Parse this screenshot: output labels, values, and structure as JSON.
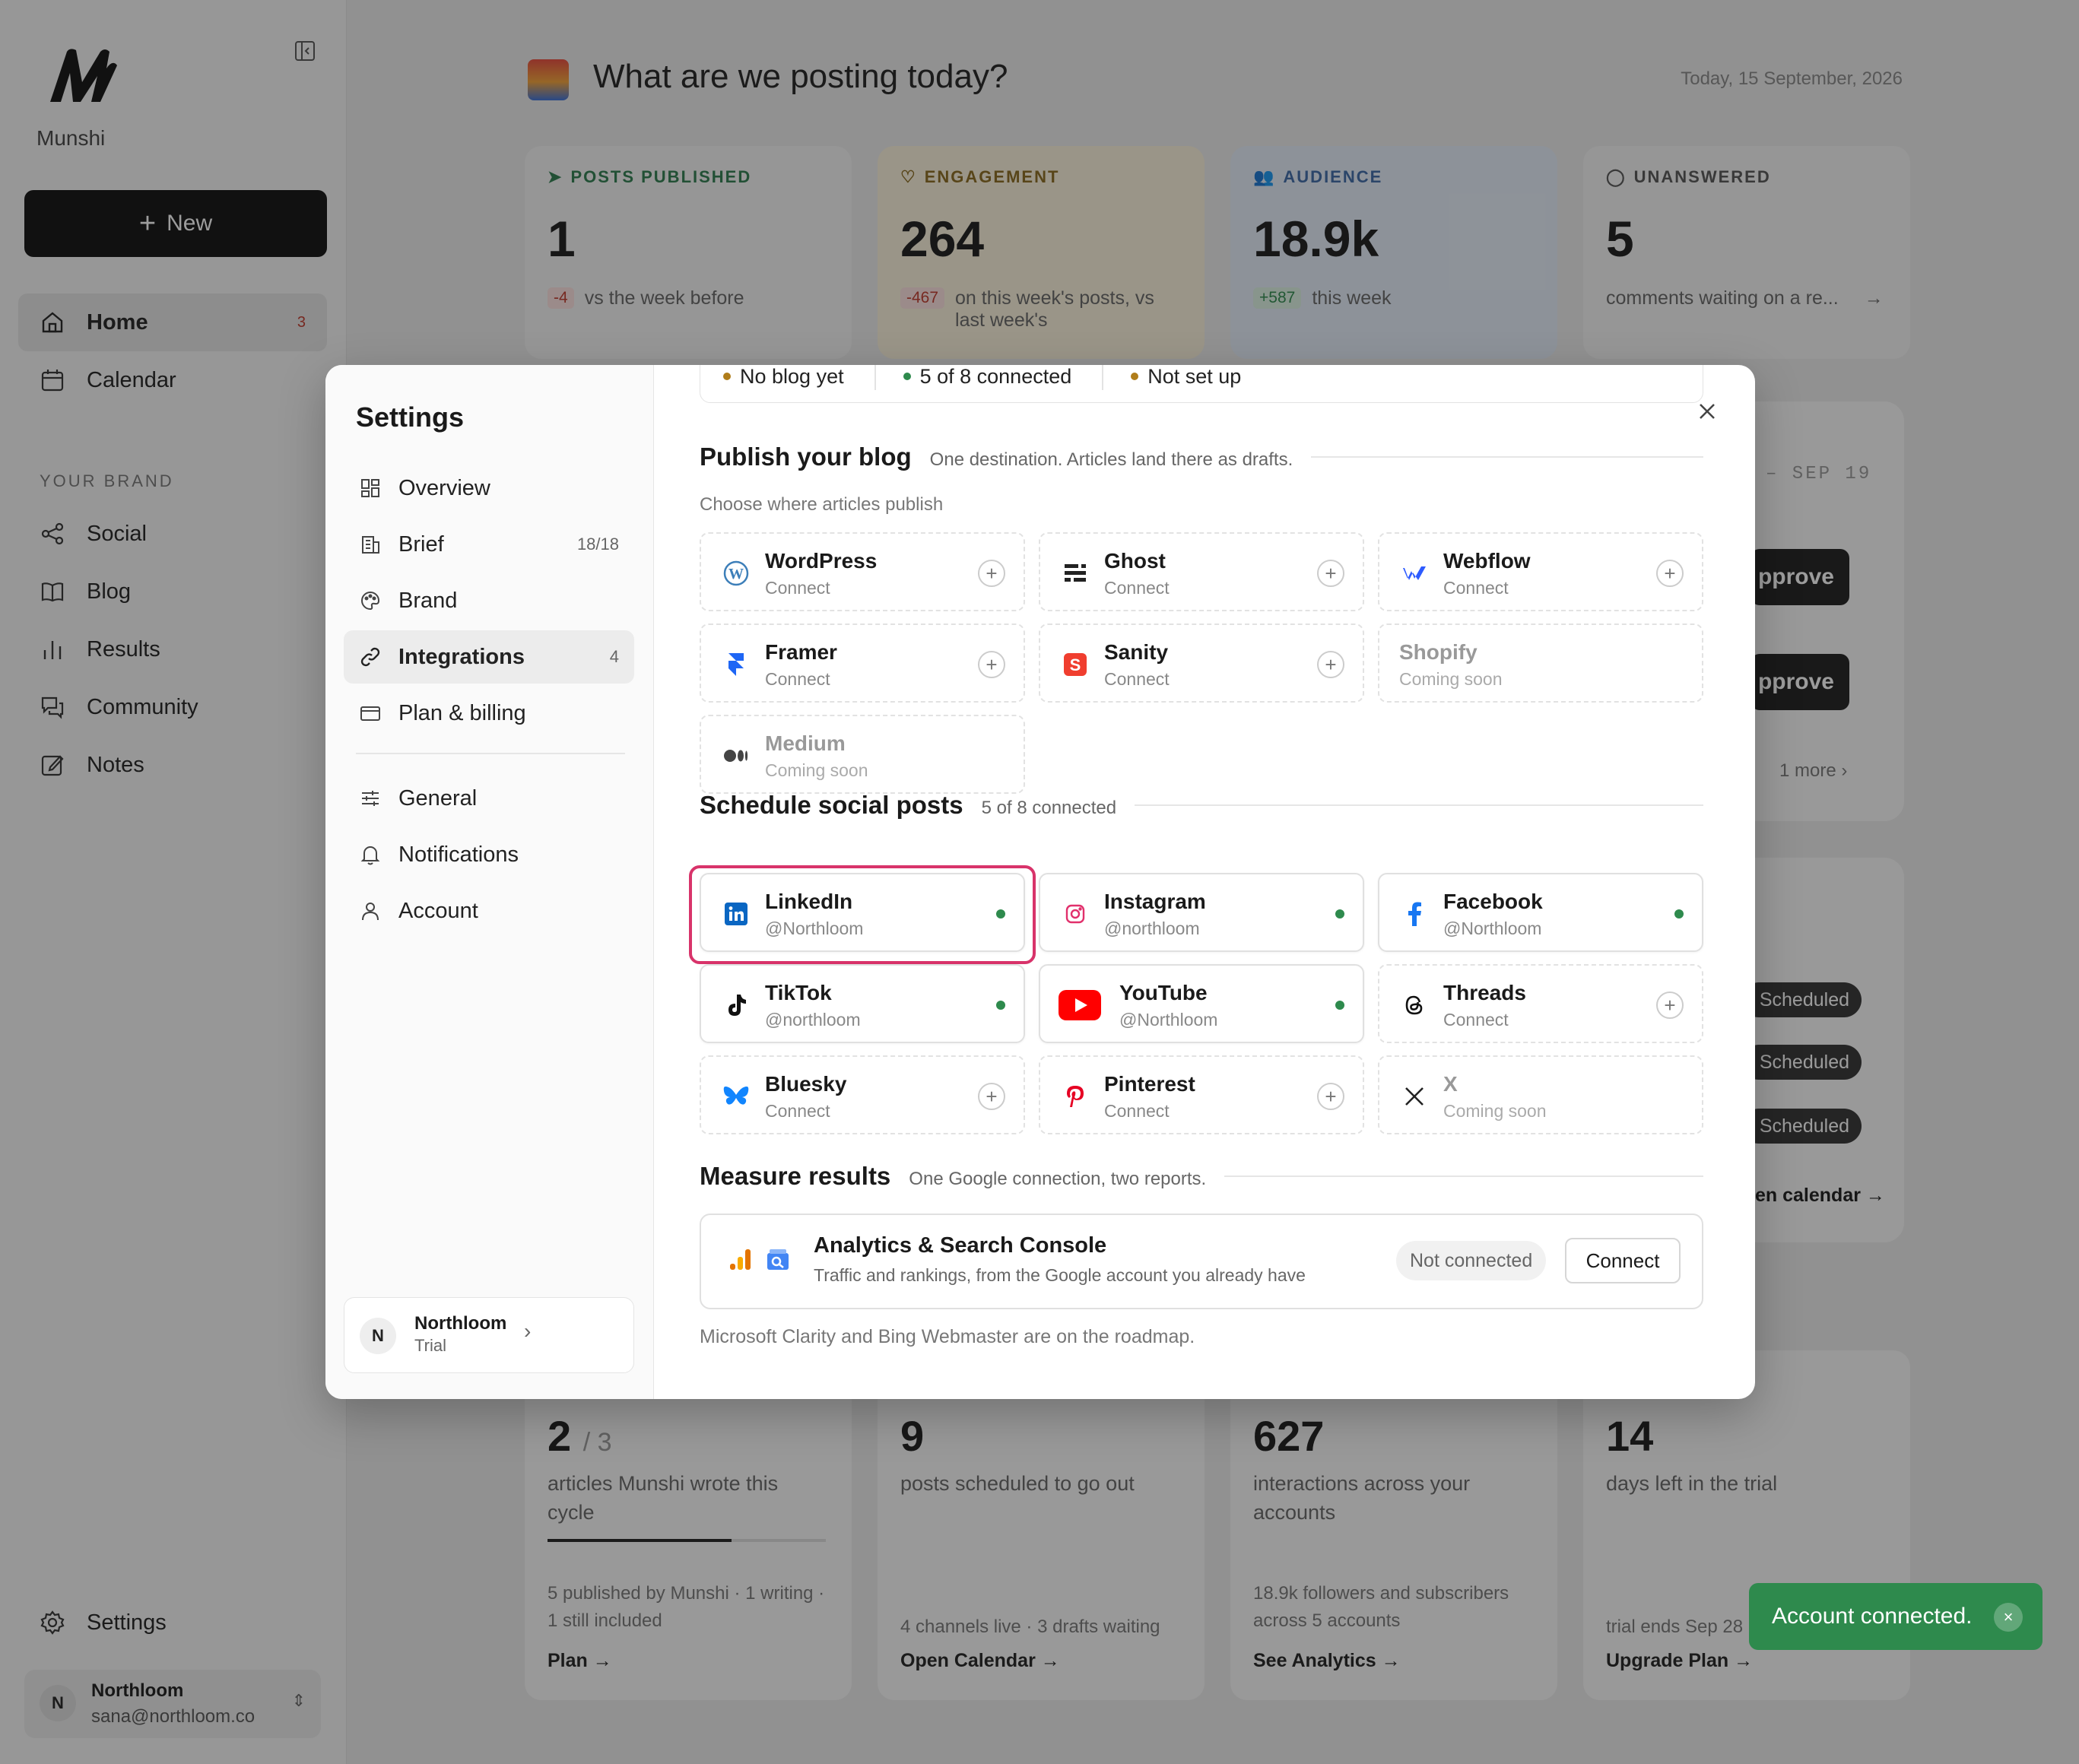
{
  "app": {
    "brand": "Munshi",
    "new_label": "New",
    "nav": [
      {
        "label": "Home",
        "count": "3"
      },
      {
        "label": "Calendar"
      }
    ],
    "section_label": "YOUR BRAND",
    "brand_nav": [
      {
        "label": "Social"
      },
      {
        "label": "Blog"
      },
      {
        "label": "Results"
      },
      {
        "label": "Community"
      },
      {
        "label": "Notes"
      }
    ],
    "settings_label": "Settings",
    "user": {
      "initial": "N",
      "name": "Northloom",
      "email": "sana@northloom.co"
    }
  },
  "dashboard": {
    "title": "What are we posting today?",
    "date": "Today, 15 September, 2026",
    "stats": [
      {
        "label": "POSTS PUBLISHED",
        "value": "1",
        "delta": "-4",
        "sub": "vs the week before",
        "color": "#2e7d4f"
      },
      {
        "label": "ENGAGEMENT",
        "value": "264",
        "delta": "-467",
        "sub": "on this week's posts, vs last week's",
        "color": "#8a6a1e"
      },
      {
        "label": "AUDIENCE",
        "value": "18.9k",
        "delta": "+587",
        "sub": "this week",
        "color": "#3d6aa8"
      },
      {
        "label": "UNANSWERED",
        "value": "5",
        "sub": "comments waiting on a re..."
      }
    ],
    "right_panel": {
      "range": "– SEP 19",
      "approve": "pprove",
      "more": "1 more",
      "scheduled": "Scheduled",
      "calendar_link": "en calendar →"
    },
    "bottom": [
      {
        "value": "2",
        "of": "/ 3",
        "desc": "articles Munshi wrote this cycle",
        "foot": "5 published by Munshi · 1 writing · 1 still included",
        "link": "Plan →",
        "progress": 0.66
      },
      {
        "value": "9",
        "desc": "posts scheduled to go out",
        "foot": "4 channels live · 3 drafts waiting",
        "link": "Open Calendar →"
      },
      {
        "value": "627",
        "desc": "interactions across your accounts",
        "foot": "18.9k followers and subscribers across 5 accounts",
        "link": "See Analytics →"
      },
      {
        "value": "14",
        "desc": "days left in the trial",
        "foot": "trial ends Sep 28",
        "link": "Upgrade Plan →"
      }
    ]
  },
  "settings": {
    "title": "Settings",
    "nav": [
      {
        "label": "Overview"
      },
      {
        "label": "Brief",
        "count": "18/18"
      },
      {
        "label": "Brand"
      },
      {
        "label": "Integrations",
        "count": "4"
      },
      {
        "label": "Plan & billing"
      },
      {
        "label": "General"
      },
      {
        "label": "Notifications"
      },
      {
        "label": "Account"
      }
    ],
    "org": {
      "initial": "N",
      "name": "Northloom",
      "plan": "Trial"
    },
    "status_strip": [
      {
        "label": "No blog yet",
        "color": "#b07d1a"
      },
      {
        "label": "5 of 8 connected",
        "color": "#2e8a4d"
      },
      {
        "label": "Not set up",
        "color": "#b07d1a"
      }
    ],
    "blog": {
      "title": "Publish your blog",
      "subtitle": "One destination. Articles land there as drafts.",
      "choose": "Choose where articles publish",
      "items": [
        {
          "name": "WordPress",
          "sub": "Connect"
        },
        {
          "name": "Ghost",
          "sub": "Connect"
        },
        {
          "name": "Webflow",
          "sub": "Connect"
        },
        {
          "name": "Framer",
          "sub": "Connect"
        },
        {
          "name": "Sanity",
          "sub": "Connect"
        },
        {
          "name": "Shopify",
          "sub": "Coming soon"
        },
        {
          "name": "Medium",
          "sub": "Coming soon"
        }
      ]
    },
    "social": {
      "title": "Schedule social posts",
      "subtitle": "5 of 8 connected",
      "items": [
        {
          "name": "LinkedIn",
          "sub": "@Northloom"
        },
        {
          "name": "Instagram",
          "sub": "@northloom"
        },
        {
          "name": "Facebook",
          "sub": "@Northloom"
        },
        {
          "name": "TikTok",
          "sub": "@northloom"
        },
        {
          "name": "YouTube",
          "sub": "@Northloom"
        },
        {
          "name": "Threads",
          "sub": "Connect"
        },
        {
          "name": "Bluesky",
          "sub": "Connect"
        },
        {
          "name": "Pinterest",
          "sub": "Connect"
        },
        {
          "name": "X",
          "sub": "Coming soon"
        }
      ]
    },
    "measure": {
      "title": "Measure results",
      "subtitle": "One Google connection, two reports.",
      "card_title": "Analytics & Search Console",
      "card_sub": "Traffic and rankings, from the Google account you already have",
      "status": "Not connected",
      "button": "Connect",
      "roadmap": "Microsoft Clarity and Bing Webmaster are on the roadmap."
    }
  },
  "toast": {
    "message": "Account connected.",
    "close": "×"
  }
}
